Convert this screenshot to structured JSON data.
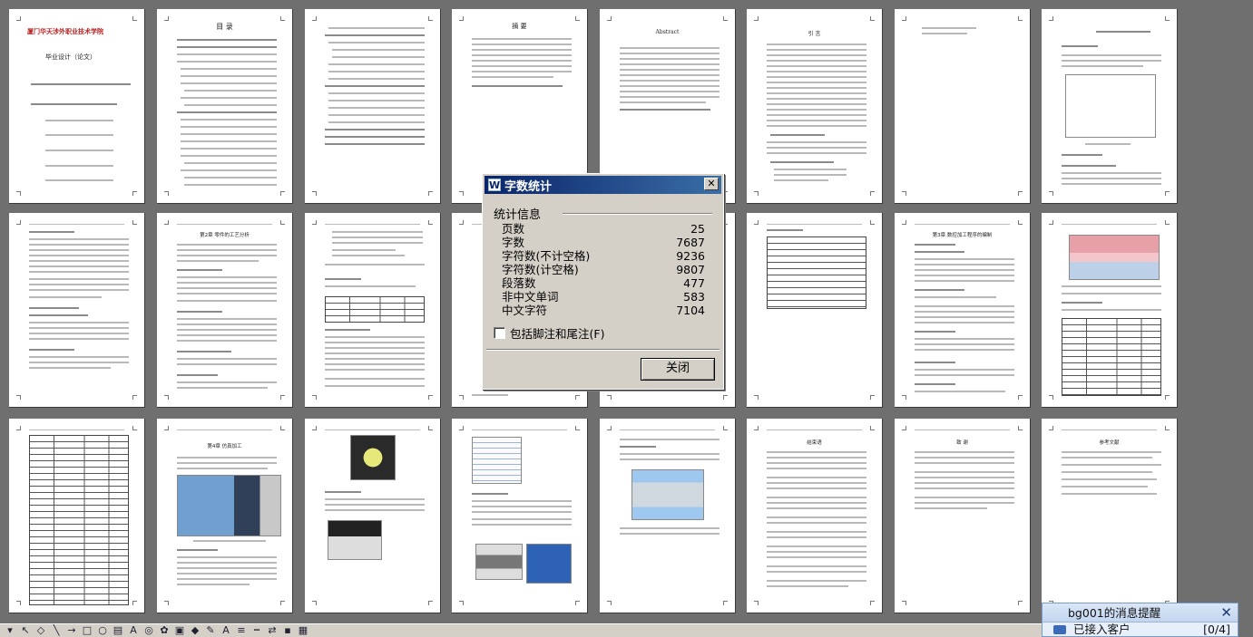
{
  "dialog": {
    "title": "字数统计",
    "app_icon": "W",
    "close_glyph": "✕",
    "group_label": "统计信息",
    "stats": [
      {
        "label": "页数",
        "value": "25"
      },
      {
        "label": "字数",
        "value": "7687"
      },
      {
        "label": "字符数(不计空格)",
        "value": "9236"
      },
      {
        "label": "字符数(计空格)",
        "value": "9807"
      },
      {
        "label": "段落数",
        "value": "477"
      },
      {
        "label": "非中文单词",
        "value": "583"
      },
      {
        "label": "中文字符",
        "value": "7104"
      }
    ],
    "include_footnotes_label": "包括脚注和尾注(F)",
    "include_footnotes_checked": false,
    "close_button_label": "关闭"
  },
  "notification": {
    "title": "bg001的消息提醒",
    "close_glyph": "✕",
    "item_label": "已接入客户",
    "item_count": "[0/4]"
  },
  "toolbar": {
    "icons": [
      "draw-menu-icon",
      "cursor-icon",
      "autoshapes-icon",
      "line-icon",
      "arrow-icon",
      "rectangle-icon",
      "oval-icon",
      "textbox-icon",
      "wordart-icon",
      "diagram-icon",
      "clipart-icon",
      "picture-icon",
      "fill-color-icon",
      "line-color-icon",
      "font-color-icon",
      "line-style-icon",
      "dash-style-icon",
      "arrow-style-icon",
      "shadow-icon",
      "3d-icon"
    ],
    "glyphs": [
      "▾",
      "↖",
      "◇",
      "╲",
      "→",
      "□",
      "○",
      "▤",
      "A",
      "◎",
      "✿",
      "▣",
      "◆",
      "✎",
      "A",
      "≡",
      "┅",
      "⇄",
      "▪",
      "▦"
    ]
  },
  "pages": {
    "cover_logo": "厦门华天涉外职业技术学院",
    "cover_title": "毕业设计（论文）",
    "toc_title": "目 录",
    "abstract_cn_title": "摘 要",
    "abstract_en_title": "Abstract",
    "intro_title": "引 言",
    "ch2_title": "第2章 零件的工艺分析",
    "ch3_title": "第3章 数控加工程序的编制",
    "ch4_title": "第4章 仿真加工",
    "conclusion_title": "结束语",
    "thanks_title": "致 谢",
    "refs_title": "参考文献"
  }
}
